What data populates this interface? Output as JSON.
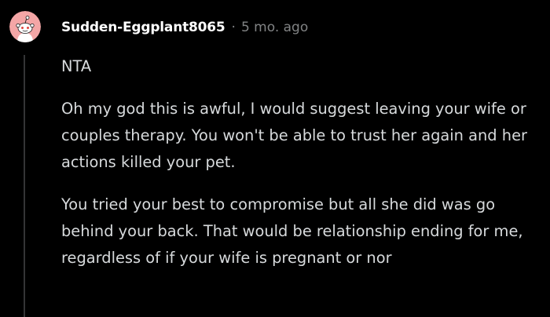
{
  "comment": {
    "author": "Sudden-Eggplant8065",
    "separator": "·",
    "timestamp": "5 mo. ago",
    "paragraphs": [
      "NTA",
      "Oh my god this is awful, I would suggest leaving your wife or couples therapy. You won't be able to trust her again and her actions killed your pet.",
      "You tried your best to compromise but all she did was go behind your back. That would be relationship ending for me, regardless of if your wife is pregnant or nor"
    ],
    "avatar_icon": "snoo-avatar-icon"
  },
  "colors": {
    "background": "#000000",
    "username": "#ffffff",
    "meta": "#818384",
    "body": "#d7dadc",
    "thread_line": "#343536",
    "avatar_bg": "#f4a6a6"
  }
}
